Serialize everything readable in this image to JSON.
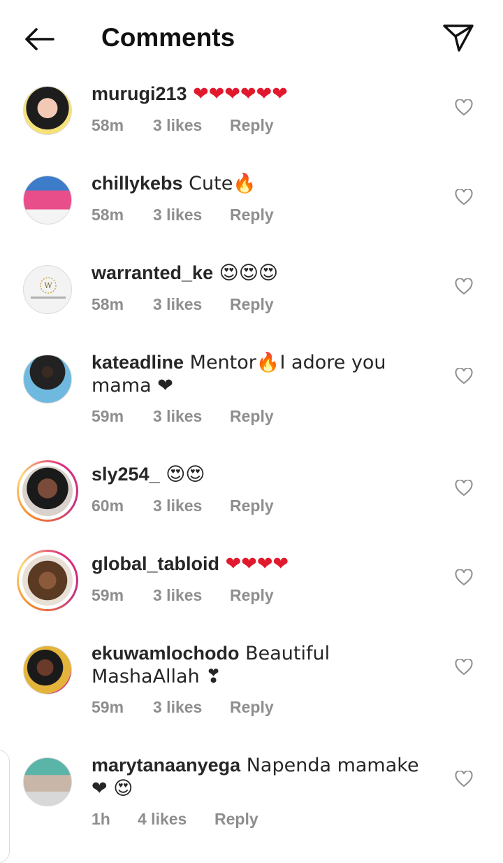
{
  "header": {
    "title": "Comments",
    "back_icon": "arrow-left-icon",
    "share_icon": "paper-plane-icon"
  },
  "colors": {
    "text": "#262626",
    "muted": "#8e8e8e",
    "heart": "#e0192e",
    "story_ring": "#dd2a7b"
  },
  "comments": [
    {
      "username": "murugi213",
      "text": " ❤❤❤❤❤❤",
      "time": "58m",
      "likes": "3 likes",
      "reply": "Reply"
    },
    {
      "username": "chillykebs",
      "text": " Cute🔥",
      "time": "58m",
      "likes": "3 likes",
      "reply": "Reply"
    },
    {
      "username": "warranted_ke",
      "text": " 😍😍😍",
      "time": "58m",
      "likes": "3 likes",
      "reply": "Reply"
    },
    {
      "username": "kateadline",
      "text": " Mentor🔥I adore you mama ❤",
      "time": "59m",
      "likes": "3 likes",
      "reply": "Reply"
    },
    {
      "username": "sly254_",
      "text": " 😍😍",
      "time": "60m",
      "likes": "3 likes",
      "reply": "Reply"
    },
    {
      "username": "global_tabloid",
      "text": " ❤❤❤❤",
      "time": "59m",
      "likes": "3 likes",
      "reply": "Reply"
    },
    {
      "username": "ekuwamlochodo",
      "text": " Beautiful MashaAllah ❣",
      "time": "59m",
      "likes": "3 likes",
      "reply": "Reply"
    },
    {
      "username": "marytanaanyega",
      "text": " Napenda mamake❤ 😍",
      "time": "1h",
      "likes": "4 likes",
      "reply": "Reply"
    }
  ]
}
